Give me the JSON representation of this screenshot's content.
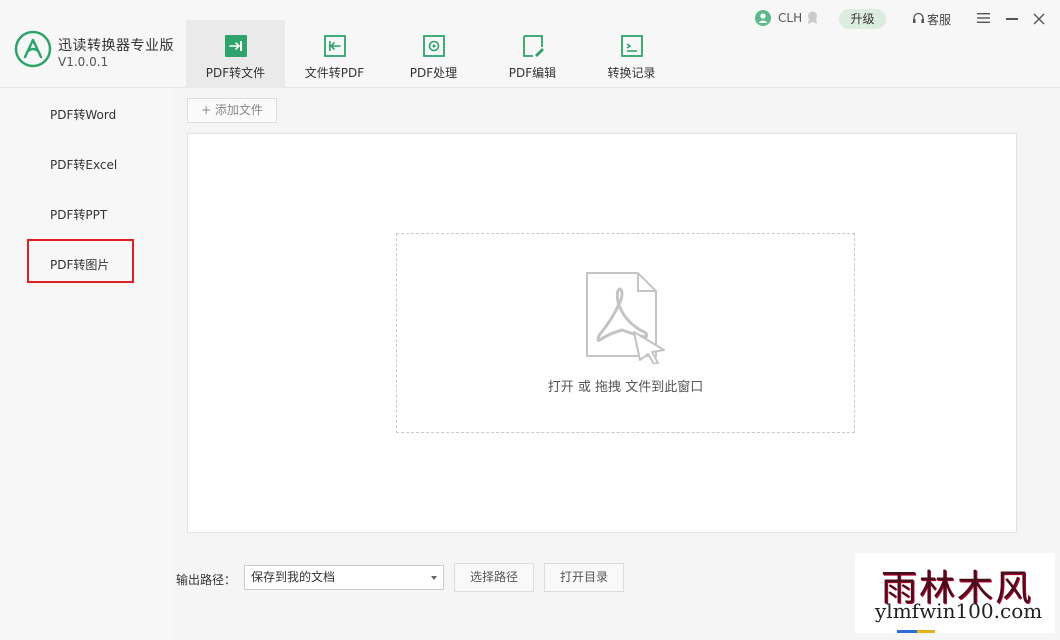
{
  "app": {
    "name": "迅读转换器专业版",
    "version": "V1.0.0.1"
  },
  "tabs": [
    {
      "label": "PDF转文件",
      "icon": "pdf-to-file-icon",
      "active": true
    },
    {
      "label": "文件转PDF",
      "icon": "file-to-pdf-icon",
      "active": false
    },
    {
      "label": "PDF处理",
      "icon": "pdf-process-icon",
      "active": false
    },
    {
      "label": "PDF编辑",
      "icon": "pdf-edit-icon",
      "active": false
    },
    {
      "label": "转换记录",
      "icon": "history-icon",
      "active": false
    }
  ],
  "topbar": {
    "user": "CLH",
    "upgrade": "升级",
    "service": "客服"
  },
  "sidebar": {
    "items": [
      {
        "label": "PDF转Word"
      },
      {
        "label": "PDF转Excel"
      },
      {
        "label": "PDF转PPT"
      },
      {
        "label": "PDF转图片",
        "highlighted": true
      }
    ]
  },
  "main": {
    "add_file": "+ 添加文件",
    "drop_text": "打开 或 拖拽 文件到此窗口"
  },
  "footer": {
    "output_label": "输出路径：",
    "output_value": "保存到我的文档",
    "choose_path": "选择路径",
    "open_dir": "打开目录"
  },
  "watermark": {
    "cn": "雨林木风",
    "url": "ylmfwin100.com"
  },
  "colors": {
    "accent": "#2ea36b",
    "highlight": "#e02020",
    "upgrade_bg": "#dcecde"
  }
}
